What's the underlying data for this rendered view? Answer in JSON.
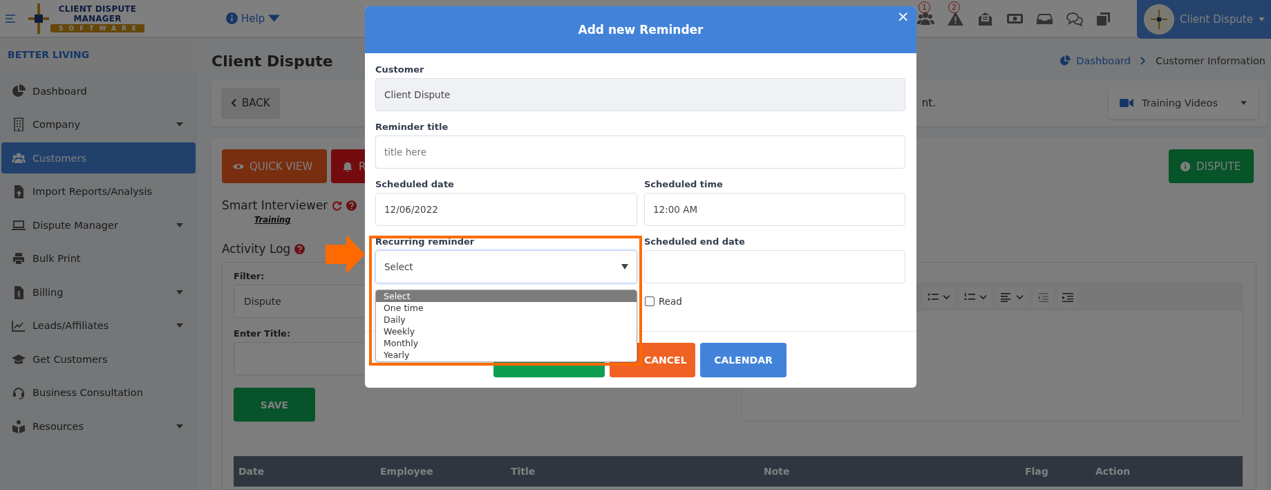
{
  "topbar": {
    "logo": {
      "line1": "CLIENT DISPUTE",
      "line2": "MANAGER",
      "band": "SOFTWARE"
    },
    "help": "Help",
    "icon_badges": [
      "1",
      "2"
    ],
    "user": "Client Dispute"
  },
  "sidebar": {
    "org": "BETTER LIVING",
    "items": [
      {
        "label": "Dashboard",
        "selected": false,
        "expandable": false
      },
      {
        "label": "Company",
        "selected": false,
        "expandable": true
      },
      {
        "label": "Customers",
        "selected": true,
        "expandable": false
      },
      {
        "label": "Import Reports/Analysis",
        "selected": false,
        "expandable": false
      },
      {
        "label": "Dispute Manager",
        "selected": false,
        "expandable": true
      },
      {
        "label": "Bulk Print",
        "selected": false,
        "expandable": false
      },
      {
        "label": "Billing",
        "selected": false,
        "expandable": true
      },
      {
        "label": "Leads/Affiliates",
        "selected": false,
        "expandable": true
      },
      {
        "label": "Get Customers",
        "selected": false,
        "expandable": false
      },
      {
        "label": "Business Consultation",
        "selected": false,
        "expandable": false
      },
      {
        "label": "Resources",
        "selected": false,
        "expandable": true
      }
    ]
  },
  "page": {
    "title": "Client Dispute",
    "breadcrumb": [
      "Dashboard",
      "Customer Information"
    ],
    "back": "BACK",
    "notice": "nt.",
    "training_videos": "Training Videos",
    "actions": [
      {
        "label": "QUICK VIEW",
        "kind": "view"
      },
      {
        "label": "R",
        "kind": "reminder"
      }
    ],
    "dispute": "DISPUTE",
    "smart_interviewer": "Smart Interviewer",
    "training_link": "Training",
    "activity_log": {
      "title": "Activity Log",
      "filter_label": "Filter:",
      "filter_value": "Dispute",
      "title_label": "Enter Title:",
      "save": "SAVE"
    },
    "table": {
      "columns": [
        "Date",
        "Employee",
        "Title",
        "Note",
        "Flag",
        "Action"
      ]
    }
  },
  "modal": {
    "title": "Add new Reminder",
    "close": "×",
    "customer": {
      "label": "Customer",
      "value": "Client Dispute",
      "disabled": true
    },
    "reminder_title": {
      "label": "Reminder title",
      "placeholder": "title here"
    },
    "scheduled_date": {
      "label": "Scheduled date",
      "value": "12/06/2022"
    },
    "scheduled_time": {
      "label": "Scheduled time",
      "value": "12:00 AM"
    },
    "recurring": {
      "label": "Recurring reminder",
      "value": "Select",
      "expanded": true,
      "options": [
        {
          "label": "Select",
          "selected": true
        },
        {
          "label": "One time",
          "selected": false
        },
        {
          "label": "Daily",
          "selected": false
        },
        {
          "label": "Weekly",
          "selected": false
        },
        {
          "label": "Monthly",
          "selected": false
        },
        {
          "label": "Yearly",
          "selected": false
        }
      ]
    },
    "scheduled_end_date": {
      "label": "Scheduled end date"
    },
    "read": {
      "label": "Read",
      "checked": false
    },
    "buttons": [
      {
        "kind": "save"
      },
      {
        "kind": "cancel",
        "label": "CANCEL"
      },
      {
        "kind": "calendar",
        "label": "CALENDAR"
      }
    ]
  }
}
